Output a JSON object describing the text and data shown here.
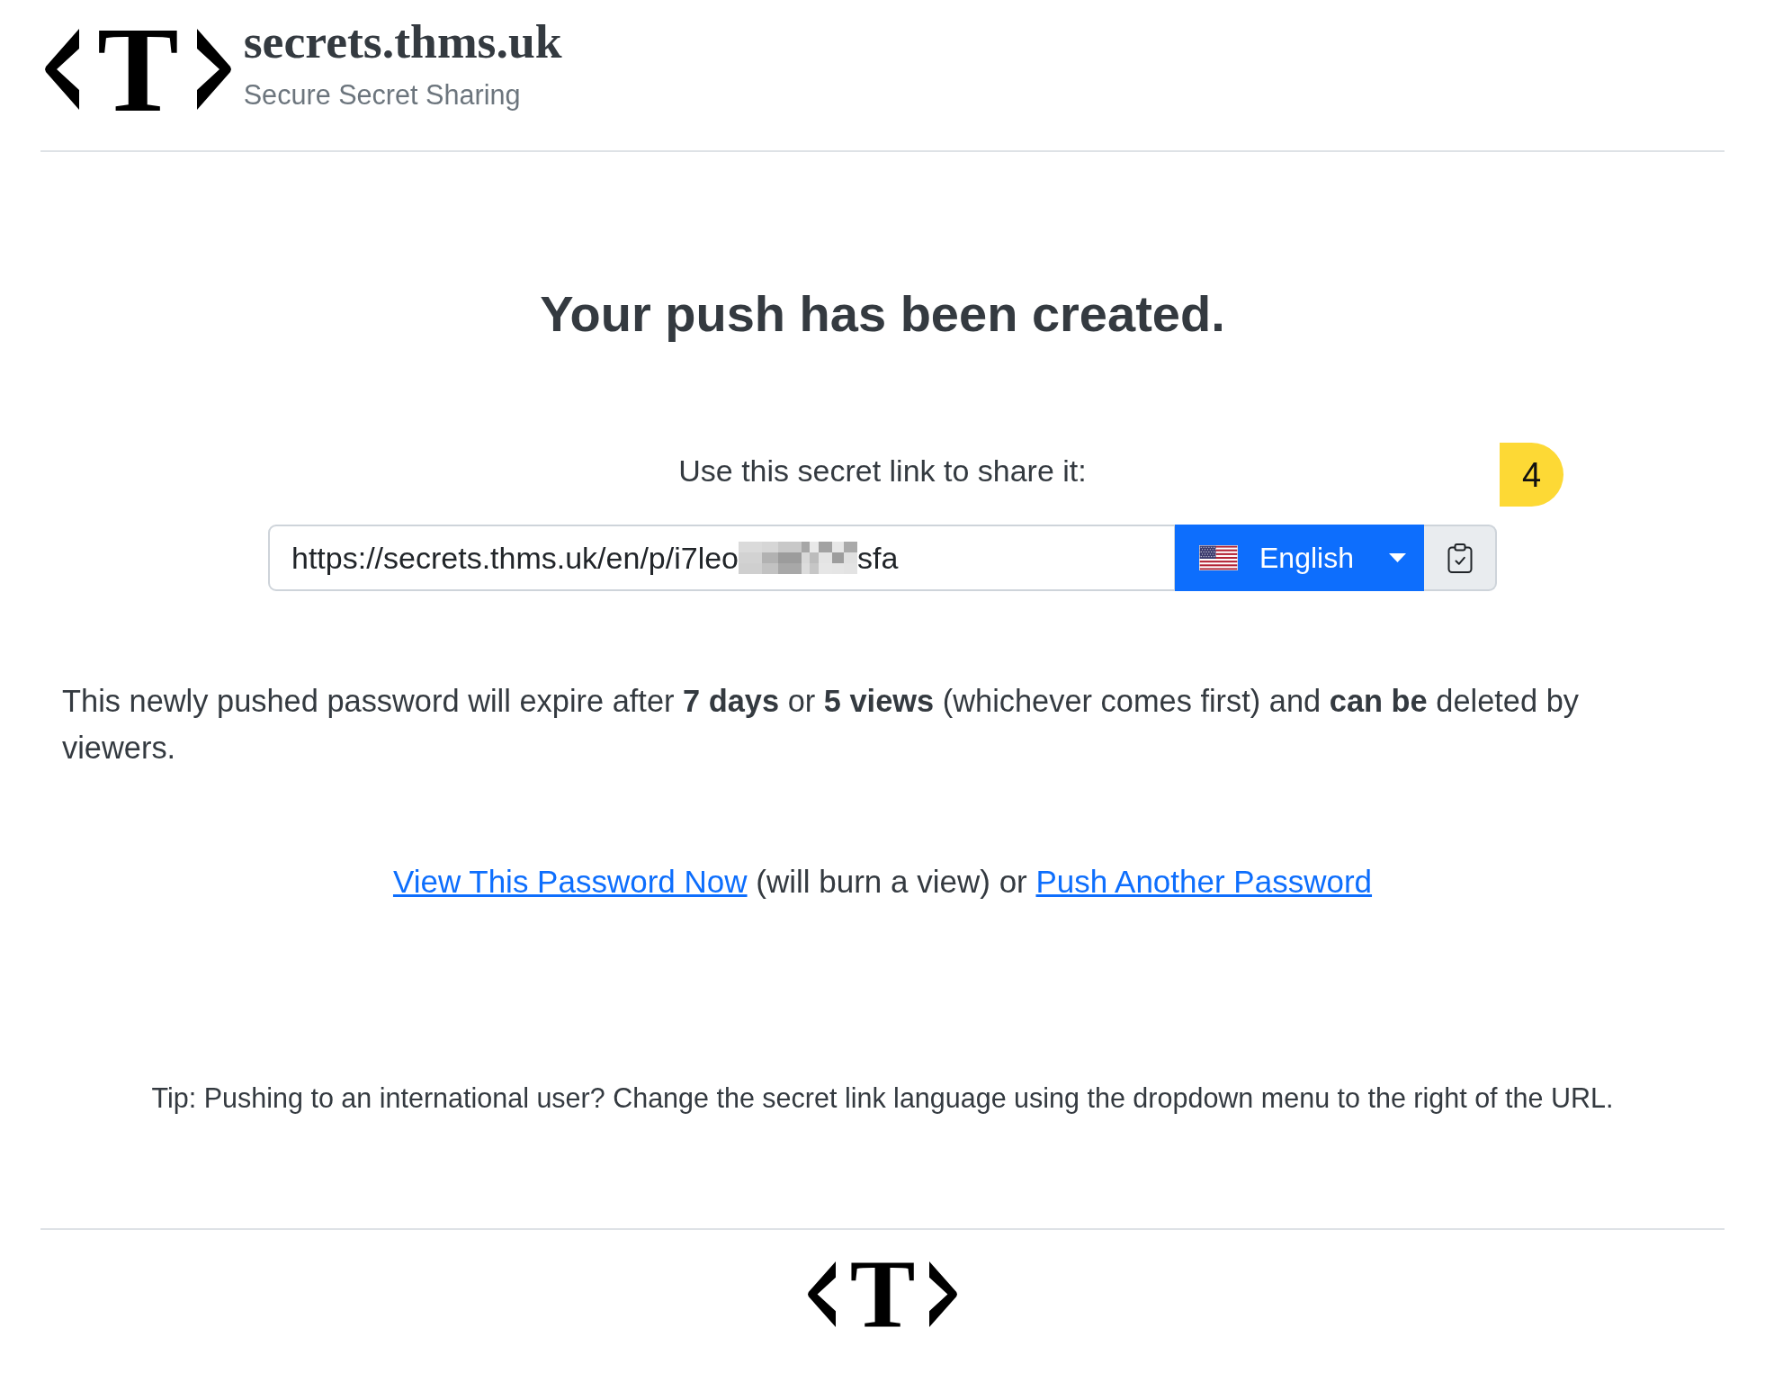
{
  "header": {
    "logo_letter": "T",
    "site_name": "secrets.thms.uk",
    "tagline": "Secure Secret Sharing"
  },
  "heading": "Your push has been created.",
  "share": {
    "prompt": "Use this secret link to share it:",
    "link_field": {
      "value_start": "https://secrets.thms.uk/en/p/i7leo",
      "value_end": "sfa",
      "redacted": true
    },
    "language_button": {
      "label": "English"
    },
    "annotation_marker": "4"
  },
  "expiry_note": "This newly pushed password will expire after **7 days** or **5 views** (whichever comes first) and **can be** deleted by viewers.",
  "actions": [
    {
      "kind": "link",
      "text": "View This Password Now"
    },
    {
      "kind": "text",
      "text": "(will burn a view) or"
    },
    {
      "kind": "link",
      "text": "Push Another Password"
    }
  ],
  "tip": "Tip: Pushing to an international user? Change the secret link language using the dropdown menu to the right of the URL.",
  "footer": {
    "logo_letter": "T"
  }
}
